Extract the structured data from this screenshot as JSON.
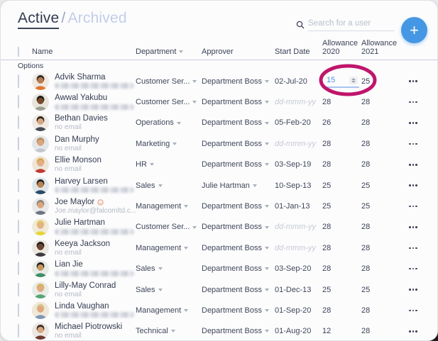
{
  "header": {
    "tab_active": "Active",
    "tab_separator": "/",
    "tab_archived": "Archived",
    "search_placeholder": "Search for a user",
    "add_button_label": "+"
  },
  "columns": {
    "name": "Name",
    "department": "Department",
    "approver": "Approver",
    "start_date": "Start Date",
    "allowance_2020_line1": "Allowance",
    "allowance_2020_line2": "2020",
    "allowance_2021_line1": "Allowance",
    "allowance_2021_line2": "2021"
  },
  "options_label": "Options",
  "strings": {
    "no_email": "no email",
    "date_placeholder": "dd-mmm-yy"
  },
  "annotation": {
    "shape": "ellipse",
    "color": "#c0156b",
    "highlights": "allowance-2020 input of Advik Sharma"
  },
  "accent": {
    "button_blue": "#4597e3",
    "input_blue": "#4a90e2",
    "input_underline": "#aac4ef"
  },
  "rows": [
    {
      "name": "Advik Sharma",
      "admin": false,
      "email_kind": "blurred",
      "email": "",
      "department": "Customer Ser...",
      "approver": "Department Boss",
      "start_date": "02-Jul-20",
      "date_is_placeholder": false,
      "allowance_2020": "15",
      "allowance_2020_editable": true,
      "allowance_2021": "25",
      "avatar": {
        "bg": "#efe9e2",
        "skin": "#b97b4e",
        "hair": "#2f2a28",
        "shirt": "#e0762f"
      }
    },
    {
      "name": "Awwal Yakubu",
      "admin": false,
      "email_kind": "blurred",
      "email": "",
      "department": "Customer Ser...",
      "approver": "Department Boss",
      "start_date": "dd-mmm-yy",
      "date_is_placeholder": true,
      "allowance_2020": "28",
      "allowance_2020_editable": false,
      "allowance_2021": "28",
      "avatar": {
        "bg": "#e8e4dc",
        "skin": "#7a4a2e",
        "hair": "#1e1a18",
        "shirt": "#9aa08e"
      }
    },
    {
      "name": "Bethan Davies",
      "admin": false,
      "email_kind": "none",
      "email": "",
      "department": "Operations",
      "approver": "Department Boss",
      "start_date": "05-Feb-20",
      "date_is_placeholder": false,
      "allowance_2020": "26",
      "allowance_2020_editable": false,
      "allowance_2021": "28",
      "avatar": {
        "bg": "#efeae4",
        "skin": "#d9a67e",
        "hair": "#2b2623",
        "shirt": "#454a55"
      }
    },
    {
      "name": "Dan Murphy",
      "admin": false,
      "email_kind": "none",
      "email": "",
      "department": "Marketing",
      "approver": "Department Boss",
      "start_date": "dd-mmm-yy",
      "date_is_placeholder": true,
      "allowance_2020": "28",
      "allowance_2020_editable": false,
      "allowance_2021": "28",
      "avatar": {
        "bg": "#e4e7ea",
        "skin": "#d9a67e",
        "hair": "#b98d5e",
        "shirt": "#c3c7cc"
      }
    },
    {
      "name": "Ellie Monson",
      "admin": false,
      "email_kind": "none",
      "email": "",
      "department": "HR",
      "approver": "Department Boss",
      "start_date": "03-Sep-19",
      "date_is_placeholder": false,
      "allowance_2020": "28",
      "allowance_2020_editable": false,
      "allowance_2021": "28",
      "avatar": {
        "bg": "#efe6da",
        "skin": "#e3ae85",
        "hair": "#d9a84e",
        "shirt": "#c23a32"
      }
    },
    {
      "name": "Harvey Larsen",
      "admin": false,
      "email_kind": "blurred",
      "email": "",
      "department": "Sales",
      "approver": "Julie Hartman",
      "start_date": "10-Sep-13",
      "date_is_placeholder": false,
      "allowance_2020": "25",
      "allowance_2020_editable": false,
      "allowance_2021": "25",
      "avatar": {
        "bg": "#dfe6ea",
        "skin": "#b9824e",
        "hair": "#20211f",
        "shirt": "#2c4a68"
      }
    },
    {
      "name": "Joe Maylor",
      "admin": true,
      "email_kind": "visible",
      "email": "Joe.maylor@falcomltd.c...",
      "department": "Management",
      "approver": "Department Boss",
      "start_date": "01-Jan-13",
      "date_is_placeholder": false,
      "allowance_2020": "25",
      "allowance_2020_editable": false,
      "allowance_2021": "25",
      "avatar": {
        "bg": "#e9e9ea",
        "skin": "#d9a67e",
        "hair": "#8c8478",
        "shirt": "#6e7683"
      }
    },
    {
      "name": "Julie Hartman",
      "admin": false,
      "email_kind": "blurred",
      "email": "",
      "department": "Customer Ser...",
      "approver": "Department Boss",
      "start_date": "dd-mmm-yy",
      "date_is_placeholder": true,
      "allowance_2020": "28",
      "allowance_2020_editable": false,
      "allowance_2021": "28",
      "avatar": {
        "bg": "#f0ead8",
        "skin": "#e3b388",
        "hair": "#e3c45e",
        "shirt": "#e8d53a"
      }
    },
    {
      "name": "Keeya Jackson",
      "admin": false,
      "email_kind": "none",
      "email": "",
      "department": "Management",
      "approver": "Department Boss",
      "start_date": "dd-mmm-yy",
      "date_is_placeholder": true,
      "allowance_2020": "28",
      "allowance_2020_editable": false,
      "allowance_2021": "28",
      "avatar": {
        "bg": "#ece7e0",
        "skin": "#6e4630",
        "hair": "#211d1b",
        "shirt": "#3f3a42"
      }
    },
    {
      "name": "Lian Jie",
      "admin": false,
      "email_kind": "blurred",
      "email": "",
      "department": "Sales",
      "approver": "Department Boss",
      "start_date": "03-Sep-20",
      "date_is_placeholder": false,
      "allowance_2020": "28",
      "allowance_2020_editable": false,
      "allowance_2021": "28",
      "avatar": {
        "bg": "#e7ebe6",
        "skin": "#c9955e",
        "hair": "#23201e",
        "shirt": "#3e8e68"
      }
    },
    {
      "name": "Lilly-May Conrad",
      "admin": false,
      "email_kind": "none",
      "email": "",
      "department": "Sales",
      "approver": "Department Boss",
      "start_date": "01-Dec-13",
      "date_is_placeholder": false,
      "allowance_2020": "25",
      "allowance_2020_editable": false,
      "allowance_2021": "25",
      "avatar": {
        "bg": "#e9ece7",
        "skin": "#e0ab80",
        "hair": "#d9b45e",
        "shirt": "#57a478"
      }
    },
    {
      "name": "Linda Vaughan",
      "admin": false,
      "email_kind": "blurred",
      "email": "",
      "department": "Management",
      "approver": "Department Boss",
      "start_date": "01-Sep-20",
      "date_is_placeholder": false,
      "allowance_2020": "28",
      "allowance_2020_editable": false,
      "allowance_2021": "28",
      "avatar": {
        "bg": "#efe8da",
        "skin": "#dfa87e",
        "hair": "#d9c08e",
        "shirt": "#7e97b9",
        "ring": "#f2c12e"
      }
    },
    {
      "name": "Michael Piotrowski",
      "admin": false,
      "email_kind": "none",
      "email": "",
      "department": "Technical",
      "approver": "Department Boss",
      "start_date": "01-Aug-20",
      "date_is_placeholder": false,
      "allowance_2020": "12",
      "allowance_2020_editable": false,
      "allowance_2021": "28",
      "avatar": {
        "bg": "#ece7e2",
        "skin": "#d9a67e",
        "hair": "#3a2f28",
        "shirt": "#6e3a30"
      }
    }
  ]
}
